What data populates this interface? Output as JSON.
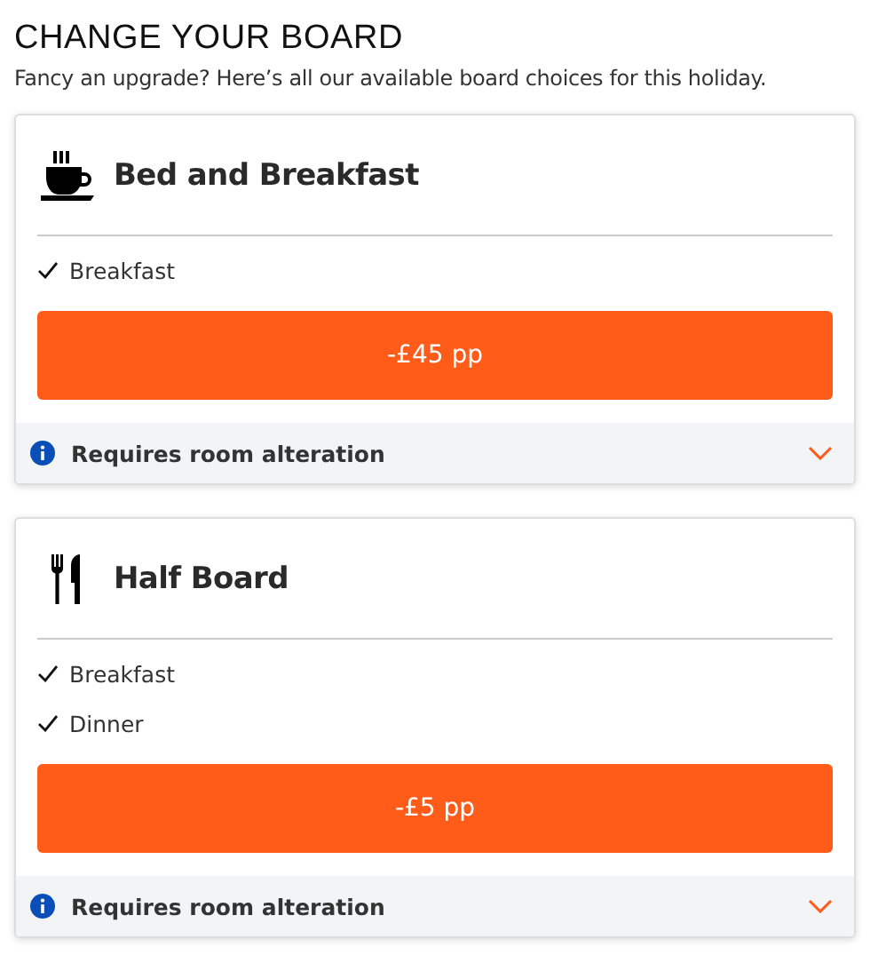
{
  "title": "CHANGE YOUR BOARD",
  "subtitle": "Fancy an upgrade? Here’s all our available board choices for this holiday.",
  "boards": [
    {
      "kind": "breakfast",
      "name": "Bed and Breakfast",
      "features": [
        "Breakfast"
      ],
      "price": "-£45 pp",
      "note": "Requires room alteration",
      "expanded": false
    },
    {
      "kind": "half",
      "name": "Half Board",
      "features": [
        "Breakfast",
        "Dinner"
      ],
      "price": "-£5 pp",
      "note": "Requires room alteration",
      "expanded": false
    }
  ]
}
